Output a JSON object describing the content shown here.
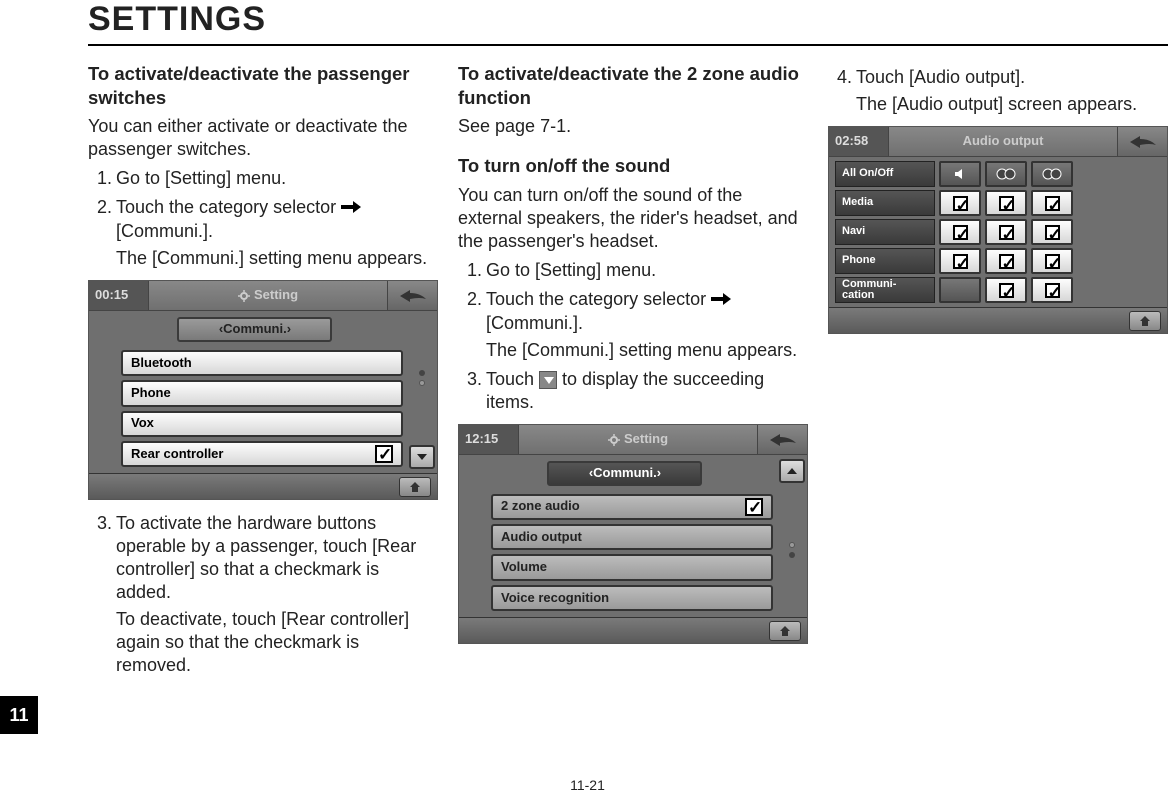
{
  "page_title": "SETTINGS",
  "page_number": "11-21",
  "section_tab": "11",
  "col1": {
    "subhead": "To activate/deactivate the passenger switches",
    "intro": "You can either activate or deactivate the passenger switches.",
    "steps": [
      {
        "num": "1.",
        "body": "Go to [Setting] menu."
      },
      {
        "num": "2.",
        "body": "Touch the category selector ",
        "tail": "[Communi.].",
        "note": "The [Communi.] setting menu appears."
      }
    ],
    "post_steps": [
      {
        "num": "3.",
        "body": "To activate the hardware buttons operable by a passenger, touch [Rear controller] so that a checkmark is added.",
        "note": "To deactivate, touch [Rear controller] again so that the checkmark is removed."
      }
    ],
    "screenshot": {
      "time": "00:15",
      "title": "Setting",
      "selector_label": "Communi.",
      "rows": [
        {
          "label": "Bluetooth",
          "check": false
        },
        {
          "label": "Phone",
          "check": null
        },
        {
          "label": "Vox",
          "check": null
        },
        {
          "label": "Rear controller",
          "check": true
        }
      ]
    }
  },
  "col2": {
    "sec1_head": "To activate/deactivate the 2 zone audio function",
    "sec1_body": "See page 7-1.",
    "sec2_head": "To turn on/off the sound",
    "sec2_body": "You can turn on/off the sound of the external speakers, the rider's headset, and the passenger's headset.",
    "steps": [
      {
        "num": "1.",
        "body": "Go to [Setting] menu."
      },
      {
        "num": "2.",
        "body": "Touch the category selector ",
        "tail": "[Communi.].",
        "note": "The [Communi.] setting menu appears."
      },
      {
        "num": "3.",
        "body_pre": "Touch ",
        "body_post": " to display the succeeding items."
      }
    ],
    "screenshot": {
      "time": "12:15",
      "title": "Setting",
      "selector_label": "Communi.",
      "rows": [
        {
          "label": "2 zone audio",
          "check": true
        },
        {
          "label": "Audio output",
          "check": null
        },
        {
          "label": "Volume",
          "check": null
        },
        {
          "label": "Voice recognition",
          "check": null
        }
      ]
    }
  },
  "col3": {
    "steps": [
      {
        "num": "4.",
        "body": "Touch [Audio output].",
        "note": "The [Audio output] screen appears."
      }
    ],
    "screenshot": {
      "time": "02:58",
      "title": "Audio output",
      "rows": [
        {
          "label": "All On/Off",
          "speaker": "icon",
          "c1": "icon",
          "c2": "icon"
        },
        {
          "label": "Media",
          "chk0": true,
          "chk1": true,
          "chk2": true
        },
        {
          "label": "Navi",
          "chk0": true,
          "chk1": true,
          "chk2": true
        },
        {
          "label": "Phone",
          "chk0": true,
          "chk1": true,
          "chk2": true
        },
        {
          "label": "Communi-\ncation",
          "chk0": null,
          "chk1": true,
          "chk2": true
        }
      ]
    }
  }
}
